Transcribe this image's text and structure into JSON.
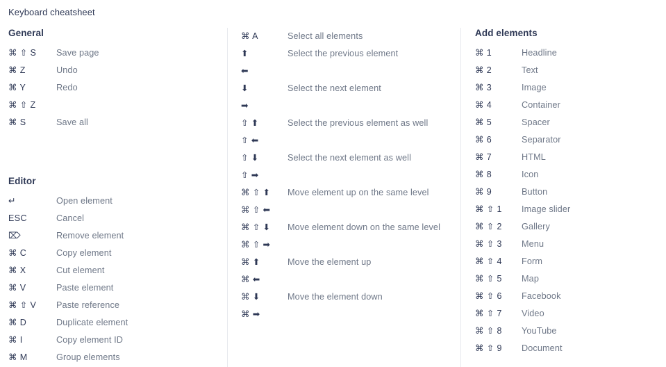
{
  "title": "Keyboard cheatsheet",
  "colors": {
    "background": "#ffffff",
    "heading": "#2e3855",
    "key": "#2e3855",
    "description": "#6f7888",
    "divider": "#e7e9ee"
  },
  "columns": [
    {
      "id": "column-left",
      "sections": [
        {
          "id": "section-general",
          "heading": "General",
          "shortcuts": [
            {
              "keys": "⌘ ⇧ S",
              "description": "Save page"
            },
            {
              "keys": "⌘ Z",
              "description": "Undo"
            },
            {
              "keys": "⌘ Y",
              "description": "Redo"
            },
            {
              "keys": "⌘ ⇧ Z",
              "description": ""
            },
            {
              "keys": "⌘ S",
              "description": "Save all"
            }
          ]
        },
        {
          "id": "section-editor",
          "heading": "Editor",
          "shortcuts": [
            {
              "keys": "↵",
              "description": "Open element"
            },
            {
              "keys": "ESC",
              "description": "Cancel"
            },
            {
              "keys": "⌦",
              "description": "Remove element"
            },
            {
              "keys": "⌘ C",
              "description": "Copy element"
            },
            {
              "keys": "⌘ X",
              "description": "Cut element"
            },
            {
              "keys": "⌘ V",
              "description": "Paste element"
            },
            {
              "keys": "⌘ ⇧ V",
              "description": "Paste reference"
            },
            {
              "keys": "⌘ D",
              "description": "Duplicate element"
            },
            {
              "keys": "⌘ I",
              "description": "Copy element ID"
            },
            {
              "keys": "⌘ M",
              "description": "Group elements"
            }
          ]
        }
      ]
    },
    {
      "id": "column-middle",
      "sections": [
        {
          "id": "section-selection",
          "heading": "",
          "shortcuts": [
            {
              "keys": "⌘ A",
              "description": "Select all elements"
            },
            {
              "keys": "⬆",
              "description": "Select the previous element"
            },
            {
              "keys": "⬅",
              "description": ""
            },
            {
              "keys": "⬇",
              "description": "Select the next element"
            },
            {
              "keys": "➡",
              "description": ""
            },
            {
              "keys": "⇧ ⬆",
              "description": "Select the previous element as well"
            },
            {
              "keys": "⇧ ⬅",
              "description": ""
            },
            {
              "keys": "⇧ ⬇",
              "description": "Select the next element as well"
            },
            {
              "keys": "⇧ ➡",
              "description": ""
            },
            {
              "keys": "⌘ ⇧ ⬆",
              "description": "Move element up on the same level"
            },
            {
              "keys": "⌘ ⇧ ⬅",
              "description": ""
            },
            {
              "keys": "⌘ ⇧ ⬇",
              "description": "Move element down on the same level"
            },
            {
              "keys": "⌘ ⇧ ➡",
              "description": ""
            },
            {
              "keys": "⌘ ⬆",
              "description": "Move the element up"
            },
            {
              "keys": "⌘ ⬅",
              "description": ""
            },
            {
              "keys": "⌘ ⬇",
              "description": "Move the element down"
            },
            {
              "keys": "⌘ ➡",
              "description": ""
            }
          ]
        }
      ]
    },
    {
      "id": "column-right",
      "sections": [
        {
          "id": "section-add-elements",
          "heading": "Add elements",
          "shortcuts": [
            {
              "keys": "⌘ 1",
              "description": "Headline"
            },
            {
              "keys": "⌘ 2",
              "description": "Text"
            },
            {
              "keys": "⌘ 3",
              "description": "Image"
            },
            {
              "keys": "⌘ 4",
              "description": "Container"
            },
            {
              "keys": "⌘ 5",
              "description": "Spacer"
            },
            {
              "keys": "⌘ 6",
              "description": "Separator"
            },
            {
              "keys": "⌘ 7",
              "description": "HTML"
            },
            {
              "keys": "⌘ 8",
              "description": "Icon"
            },
            {
              "keys": "⌘ 9",
              "description": "Button"
            },
            {
              "keys": "⌘ ⇧ 1",
              "description": "Image slider"
            },
            {
              "keys": "⌘ ⇧ 2",
              "description": "Gallery"
            },
            {
              "keys": "⌘ ⇧ 3",
              "description": "Menu"
            },
            {
              "keys": "⌘ ⇧ 4",
              "description": "Form"
            },
            {
              "keys": "⌘ ⇧ 5",
              "description": "Map"
            },
            {
              "keys": "⌘ ⇧ 6",
              "description": "Facebook"
            },
            {
              "keys": "⌘ ⇧ 7",
              "description": "Video"
            },
            {
              "keys": "⌘ ⇧ 8",
              "description": "YouTube"
            },
            {
              "keys": "⌘ ⇧ 9",
              "description": "Document"
            }
          ]
        }
      ]
    }
  ]
}
